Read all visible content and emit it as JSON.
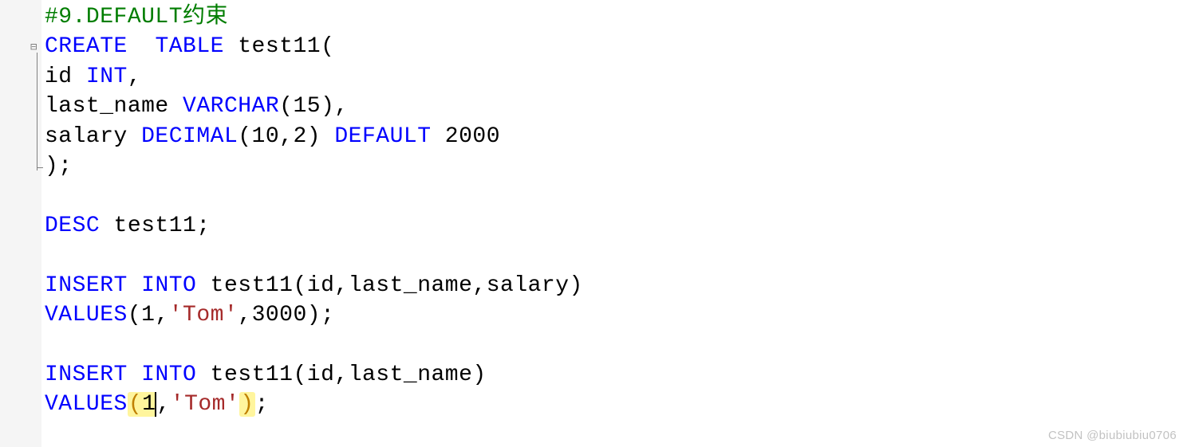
{
  "code": {
    "comment": "#9.DEFAULT约束",
    "l2": {
      "kw1": "CREATE",
      "kw2": "TABLE",
      "tbl": " test11",
      "paren": "("
    },
    "l3": {
      "col": "id ",
      "type": "INT",
      "tail": ","
    },
    "l4": {
      "col": "last_name ",
      "type": "VARCHAR",
      "args": "(15)",
      "tail": ","
    },
    "l5": {
      "col": "salary ",
      "type": "DECIMAL",
      "args": "(10,2) ",
      "kw": "DEFAULT",
      "val": " 2000"
    },
    "l6": ");",
    "l8": {
      "kw": "DESC",
      "rest": " test11;"
    },
    "l10": {
      "kw1": "INSERT",
      "kw2": "INTO",
      "rest": " test11(id,last_name,salary)"
    },
    "l11": {
      "kw": "VALUES",
      "open": "(",
      "v1": "1,",
      "str": "'Tom'",
      "v2": ",3000);"
    },
    "l13": {
      "kw1": "INSERT",
      "kw2": "INTO",
      "rest": " test11(id,last_name)"
    },
    "l14": {
      "kw": "VALUES",
      "open": "(",
      "cur": "1",
      "mid": ",",
      "str": "'Tom'",
      "close": ")",
      "semi": ";"
    }
  },
  "gutter": {
    "fold_symbol": "⊟"
  },
  "watermark": "CSDN @biubiubiu0706"
}
